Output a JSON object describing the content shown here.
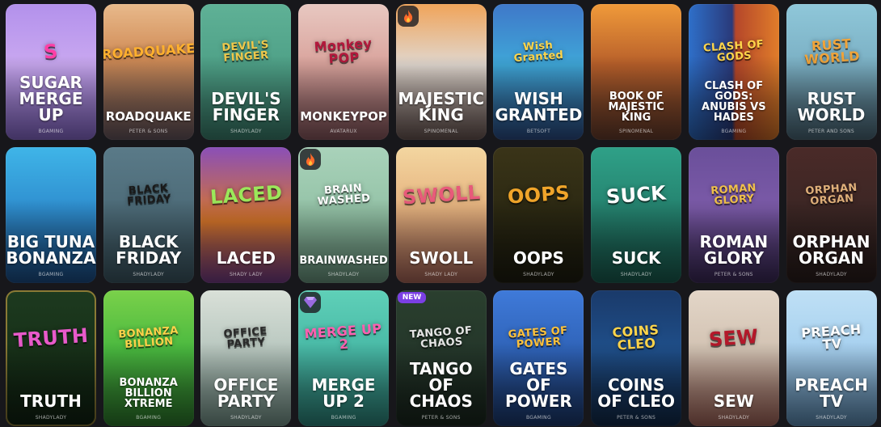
{
  "tiles": [
    {
      "title": "Sugar Merge Up",
      "provider": "BGAMING",
      "logo": "S",
      "size": "l",
      "bg": "linear-gradient(180deg,#b391ec 0%,#c9a8f0 45%,#8f6fd8 100%)",
      "logo_color": "#ff3fa6"
    },
    {
      "title": "Roadquake",
      "provider": "PETER & SONS",
      "logo": "ROADQUAKE",
      "size": "m",
      "bg": "linear-gradient(180deg,#e8b98b 0%,#d08b55 40%,#6b5a63 100%)",
      "logo_color": "#ffb02e"
    },
    {
      "title": "Devil's Finger",
      "provider": "SHADYLADY",
      "logo": "DEVIL'S FINGER",
      "size": "l",
      "bg": "linear-gradient(180deg,#5fb196 0%,#4d9f86 50%,#3e8572 100%)",
      "logo_color": "#f0c84a"
    },
    {
      "title": "MonkeyPop",
      "provider": "AVATARUX",
      "logo": "Monkey POP",
      "size": "m",
      "bg": "linear-gradient(180deg,#e8c8c1 0%,#d9a39c 45%,#8f5c63 100%)",
      "logo_color": "#b4183c"
    },
    {
      "title": "Majestic King",
      "provider": "SPINOMENAL",
      "logo": "",
      "size": "l",
      "bg": "linear-gradient(180deg,#f0a45a 0%,#e0d7cf 45%,#6e5a56 100%)",
      "logo_color": "#ffffff",
      "fire": true
    },
    {
      "title": "Wish Granted",
      "provider": "BETSOFT",
      "logo": "Wish Granted",
      "size": "l",
      "bg": "linear-gradient(180deg,#3f78c9 0%,#3fa7d8 45%,#2d4f8a 100%)",
      "logo_color": "#ffd54a"
    },
    {
      "title": "Book of Majestic King",
      "provider": "SPINOMENAL",
      "logo": "",
      "size": "s",
      "bg": "linear-gradient(180deg,#f09a3a 0%,#b75f2a 45%,#6b3f2e 100%)",
      "logo_color": "#ffffff"
    },
    {
      "title": "Clash of Gods: Anubis vs Hades",
      "provider": "BGAMING",
      "logo": "CLASH OF GODS",
      "size": "s",
      "bg": "linear-gradient(90deg,#2e6fc9 0%,#2a3a7a 48%,#b5472a 52%,#e07d2a 100%)",
      "logo_color": "#ffd54a"
    },
    {
      "title": "Rust World",
      "provider": "PETER AND SONS",
      "logo": "RUST WORLD",
      "size": "l",
      "bg": "linear-gradient(180deg,#8fc7d9 0%,#7bb0c4 45%,#4d6a7a 100%)",
      "logo_color": "#f0a43a"
    },
    {
      "title": "Big Tuna Bonanza",
      "provider": "BGAMING",
      "logo": "",
      "size": "l",
      "bg": "linear-gradient(180deg,#3fb5e8 0%,#2f8fd0 45%,#1c4f8a 100%)",
      "logo_color": "#ffffff"
    },
    {
      "title": "Black Friday",
      "provider": "SHADYLADY",
      "logo": "BLACK FRIDAY",
      "size": "l",
      "bg": "linear-gradient(180deg,#5a7a88 0%,#4c6a77 50%,#3e5a66 100%)",
      "logo_color": "#1a1a1a"
    },
    {
      "title": "Laced",
      "provider": "SHADY LADY",
      "logo": "LACED",
      "size": "l",
      "bg": "linear-gradient(180deg,#8a4fb8 0%,#d9772a 55%,#7a3f8f 100%)",
      "logo_color": "#9be85a"
    },
    {
      "title": "Brainwashed",
      "provider": "SHADYLADY",
      "logo": "BRAIN WASHED",
      "size": "s",
      "bg": "linear-gradient(180deg,#a9d2ba 0%,#93c2a6 50%,#6e9c84 100%)",
      "logo_color": "#ffffff",
      "fire": true
    },
    {
      "title": "Swoll",
      "provider": "SHADY LADY",
      "logo": "SWOLL",
      "size": "l",
      "bg": "linear-gradient(180deg,#f3d6a0 0%,#e6b37f 45%,#b06a5c 100%)",
      "logo_color": "#e85a7a"
    },
    {
      "title": "Oops",
      "provider": "SHADYLADY",
      "logo": "OOPS",
      "size": "l",
      "bg": "linear-gradient(180deg,#3a3418 0%,#2b2812 50%,#1e1d10 100%)",
      "logo_color": "#f0a52a"
    },
    {
      "title": "Suck",
      "provider": "SHADYLADY",
      "logo": "SUCK",
      "size": "l",
      "bg": "linear-gradient(180deg,#2fa188 0%,#24806d 50%,#1a5f52 100%)",
      "logo_color": "#ffffff"
    },
    {
      "title": "Roman Glory",
      "provider": "PETER & SONS",
      "logo": "ROMAN GLORY",
      "size": "l",
      "bg": "linear-gradient(180deg,#6a4f9a 0%,#7b5aa8 45%,#3c2a5a 100%)",
      "logo_color": "#f0c04a"
    },
    {
      "title": "Orphan Organ",
      "provider": "SHADYLADY",
      "logo": "ORPHAN ORGAN",
      "size": "l",
      "bg": "linear-gradient(180deg,#4a2a28 0%,#3b2624 50%,#2a1d1c 100%)",
      "logo_color": "#e0b07a"
    },
    {
      "title": "Truth",
      "provider": "SHADYLADY",
      "logo": "TRUTH",
      "size": "l",
      "bg": "linear-gradient(180deg,#1d3a1f 0%,#173018 50%,#102212 100%)",
      "logo_color": "#e85aca",
      "frame": true
    },
    {
      "title": "Bonanza Billion Xtreme",
      "provider": "BGAMING",
      "logo": "BONANZA BILLION",
      "size": "s",
      "bg": "linear-gradient(180deg,#7ad14a 0%,#49b83f 45%,#2f7f2e 100%)",
      "logo_color": "#ffd24a"
    },
    {
      "title": "Office Party",
      "provider": "SHADYLADY",
      "logo": "OFFICE PARTY",
      "size": "l",
      "bg": "linear-gradient(180deg,#d9e0d8 0%,#b8c7bf 45%,#7a9a90 100%)",
      "logo_color": "#2a2a2a"
    },
    {
      "title": "Merge Up 2",
      "provider": "BGAMING",
      "logo": "MERGE UP 2",
      "size": "l",
      "bg": "linear-gradient(180deg,#5fd0b8 0%,#48b9a6 45%,#2e8a80 100%)",
      "logo_color": "#ff5fb0",
      "gem": true
    },
    {
      "title": "Tango of Chaos",
      "provider": "PETER & SONS",
      "logo": "TANGO OF CHAOS",
      "size": "l",
      "bg": "linear-gradient(180deg,#2a3f2e 0%,#24362a 50%,#1a271e 100%)",
      "logo_color": "#e6e6e6",
      "new": true
    },
    {
      "title": "Gates of Power",
      "provider": "BGAMING",
      "logo": "GATES OF POWER",
      "size": "l",
      "bg": "linear-gradient(180deg,#3f7ad9 0%,#2f63b8 45%,#1c3a70 100%)",
      "logo_color": "#ffc23a"
    },
    {
      "title": "Coins of Cleo",
      "provider": "PETER & SONS",
      "logo": "COINS CLEO",
      "size": "l",
      "bg": "linear-gradient(180deg,#1a3a6a 0%,#1f4f8a 45%,#122a4a 100%)",
      "logo_color": "#ffd54a"
    },
    {
      "title": "Sew",
      "provider": "SHADYLADY",
      "logo": "SEW",
      "size": "l",
      "bg": "linear-gradient(180deg,#e3d6c8 0%,#d2c2b2 45%,#a8685c 100%)",
      "logo_color": "#b4182a"
    },
    {
      "title": "Preach TV",
      "provider": "SHADYLADY",
      "logo": "PREACH TV",
      "size": "l",
      "bg": "linear-gradient(180deg,#bfe0f5 0%,#a6d0ef 45%,#5f8fb8 100%)",
      "logo_color": "#ffffff"
    }
  ],
  "badge_new_label": "NEW",
  "fire_icon": "fire-icon",
  "gem_icon": "gem-icon"
}
